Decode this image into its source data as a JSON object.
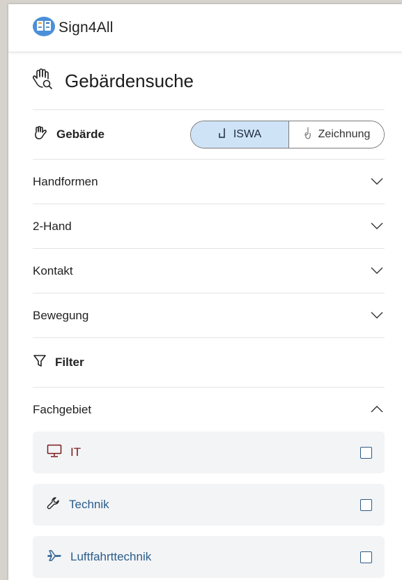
{
  "header": {
    "logo_text": "Sign4All",
    "logo_icon": "book-logo-icon"
  },
  "page": {
    "title": "Gebärdensuche",
    "title_icon": "hand-search-icon"
  },
  "gebaerde": {
    "label": "Gebärde",
    "icon": "hand-sign-icon",
    "toggle": {
      "iswa_label": "ISWA",
      "zeichnung_label": "Zeichnung",
      "selected": "ISWA"
    }
  },
  "accordions": [
    {
      "label": "Handformen",
      "expanded": false
    },
    {
      "label": "2-Hand",
      "expanded": false
    },
    {
      "label": "Kontakt",
      "expanded": false
    },
    {
      "label": "Bewegung",
      "expanded": false
    }
  ],
  "filter": {
    "label": "Filter",
    "icon": "funnel-icon"
  },
  "fachgebiet": {
    "label": "Fachgebiet",
    "expanded": true,
    "items": [
      {
        "label": "IT",
        "icon": "monitor-icon",
        "checked": false
      },
      {
        "label": "Technik",
        "icon": "wrench-icon",
        "checked": false
      },
      {
        "label": "Luftfahrttechnik",
        "icon": "airplane-icon",
        "checked": false
      }
    ]
  },
  "colors": {
    "toggle_active_bg": "#cfe3f7",
    "it_color": "#7a1a1a",
    "category_blue": "#2a5d8c",
    "item_bg": "#f3f4f6"
  }
}
